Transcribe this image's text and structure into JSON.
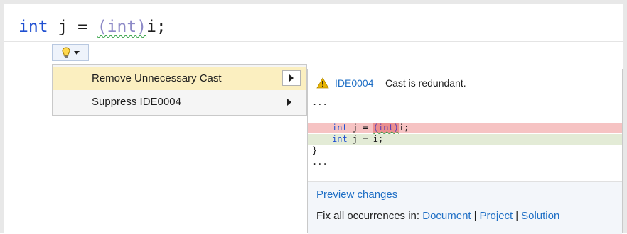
{
  "editor": {
    "code": {
      "keyword": "int",
      "before_cast": " j = ",
      "cast_open": "(",
      "cast_type": "int",
      "cast_close": ")",
      "after_cast": "i;"
    }
  },
  "lightbulb": {
    "icon": "lightbulb-icon",
    "dropdown_icon": "chevron-down-icon"
  },
  "menu": {
    "items": [
      {
        "label": "Remove Unnecessary Cast",
        "selected": true
      },
      {
        "label": "Suppress IDE0004",
        "selected": false
      }
    ]
  },
  "preview": {
    "header": {
      "icon": "warning-icon",
      "code": "IDE0004",
      "message": "Cast is redundant."
    },
    "lines": [
      {
        "type": "context",
        "text": "..."
      },
      {
        "type": "blank",
        "text": ""
      },
      {
        "type": "removed",
        "keyword": "int",
        "before": " j = ",
        "cast": "(int)",
        "after": "i;"
      },
      {
        "type": "added",
        "keyword": "int",
        "rest": " j = i;"
      },
      {
        "type": "context",
        "text": "}"
      },
      {
        "type": "context",
        "text": "..."
      }
    ],
    "preview_changes_label": "Preview changes",
    "fix_all_label": "Fix all occurrences in:",
    "scopes": [
      "Document",
      "Project",
      "Solution"
    ],
    "scope_separator": "|"
  },
  "colors": {
    "keyword": "#1f4fd1",
    "link": "#1f6fc5",
    "selected_menu": "#fbefc0",
    "removed_line": "#f6c3c3",
    "added_line": "#e3ebd6",
    "warning": "#e8b400"
  }
}
